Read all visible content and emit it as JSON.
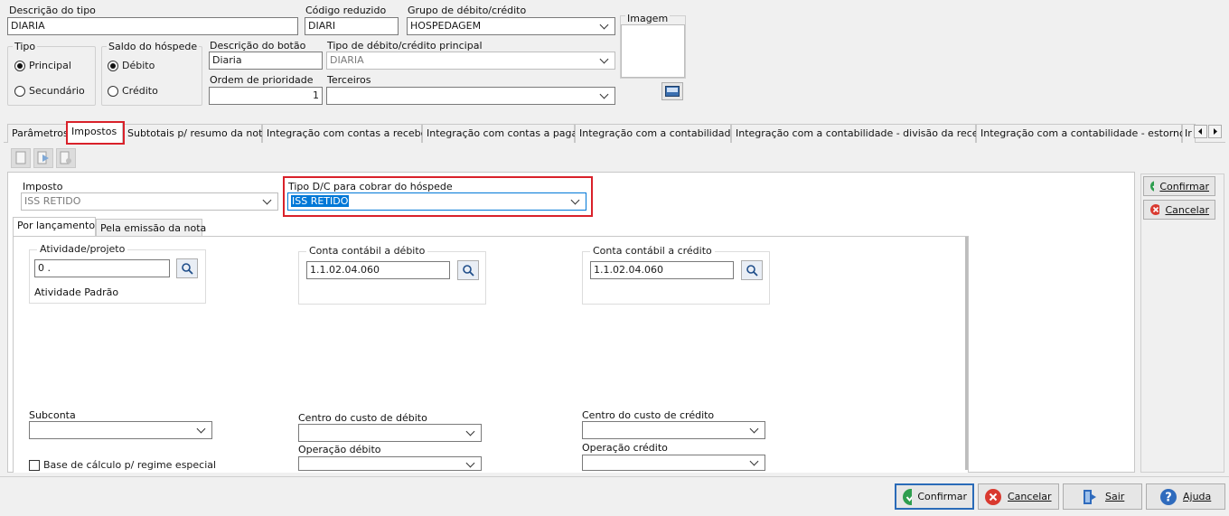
{
  "header": {
    "descricao_tipo_label": "Descrição do tipo",
    "descricao_tipo_value": "DIARIA",
    "codigo_reduzido_label": "Código reduzido",
    "codigo_reduzido_value": "DIARI",
    "grupo_label": "Grupo de débito/crédito",
    "grupo_value": "HOSPEDAGEM",
    "imagem_label": "Imagem",
    "tipo_label": "Tipo",
    "tipo_options": [
      "Principal",
      "Secundário"
    ],
    "saldo_label": "Saldo do hóspede",
    "saldo_options": [
      "Débito",
      "Crédito"
    ],
    "descricao_botao_label": "Descrição do botão",
    "descricao_botao_value": "Diaria",
    "ordem_label": "Ordem de prioridade",
    "ordem_value": "1",
    "tipo_principal_label": "Tipo de débito/crédito principal",
    "tipo_principal_value": "DIARIA",
    "terceiros_label": "Terceiros",
    "terceiros_value": ""
  },
  "tabs": [
    "Parâmetros",
    "Impostos",
    "Subtotais p/ resumo da nota",
    "Integração com contas a receber",
    "Integração com contas a pagar",
    "Integração com a contabilidade",
    "Integração com a contabilidade - divisão da receita",
    "Integração com a contabilidade - estorno",
    "Ir"
  ],
  "impostos": {
    "imposto_label": "Imposto",
    "imposto_value": "ISS RETIDO",
    "tipo_dc_label": "Tipo D/C para cobrar do hóspede",
    "tipo_dc_value": "ISS RETIDO",
    "subtabs": [
      "Por lançamento",
      "Pela emissão da nota"
    ],
    "atividade_label": "Atividade/projeto",
    "atividade_value": "0 .",
    "atividade_desc": "Atividade Padrão",
    "conta_debito_label": "Conta contábil a débito",
    "conta_debito_value": "1.1.02.04.060",
    "conta_credito_label": "Conta contábil a crédito",
    "conta_credito_value": "1.1.02.04.060",
    "subconta_label": "Subconta",
    "centro_debito_label": "Centro do custo de débito",
    "centro_credito_label": "Centro do custo de crédito",
    "operacao_debito_label": "Operação débito",
    "operacao_credito_label": "Operação crédito",
    "base_calculo_label": "Base de cálculo p/ regime especial"
  },
  "side_buttons": {
    "confirmar": "Confirmar",
    "cancelar": "Cancelar"
  },
  "footer_buttons": {
    "confirmar": "Confirmar",
    "cancelar": "Cancelar",
    "sair": "Sair",
    "ajuda": "Ajuda"
  },
  "colors": {
    "highlight_red": "#d9212a",
    "selection_blue": "#0078d7",
    "confirm_green": "#2e9e4f",
    "cancel_red": "#d9392f",
    "help_blue": "#2f6bbd"
  }
}
